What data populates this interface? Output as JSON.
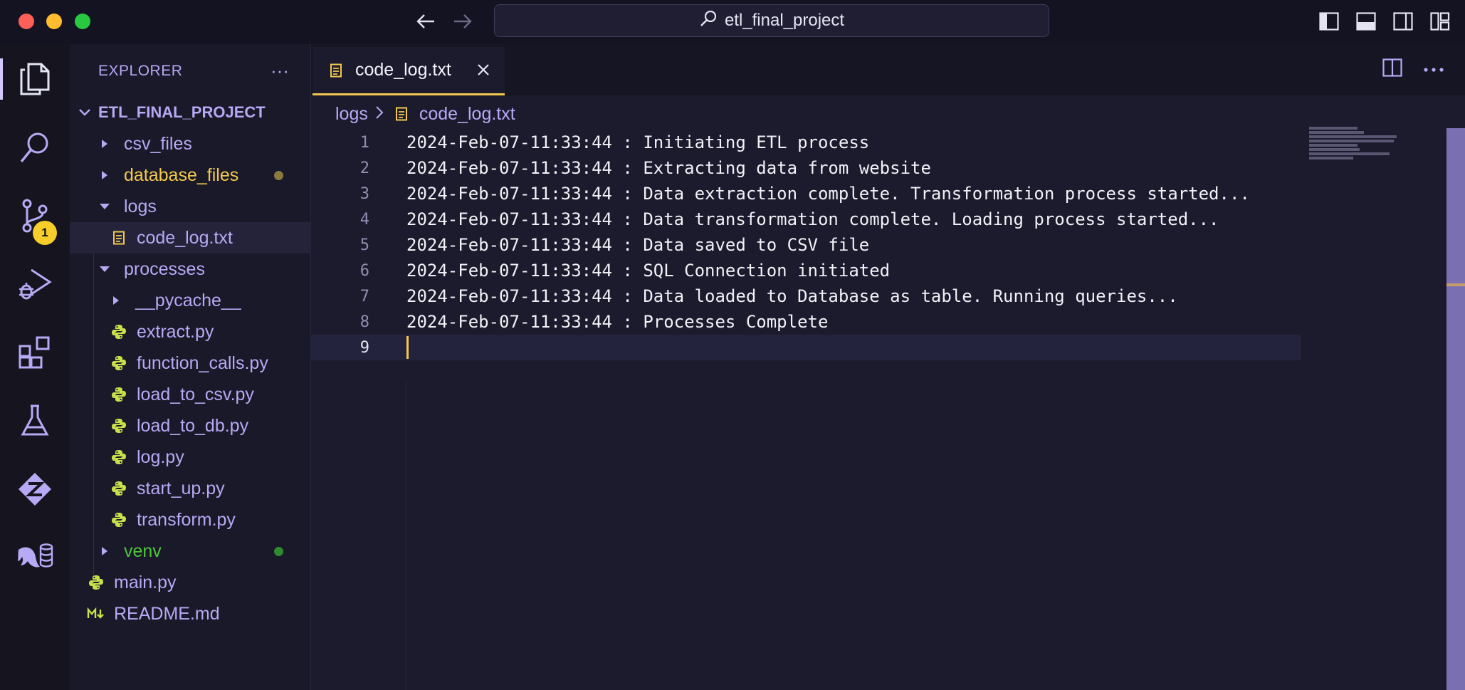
{
  "window": {
    "search_text": "etl_final_project"
  },
  "activity_bar": {
    "source_control_badge": "1"
  },
  "sidebar": {
    "header": "EXPLORER",
    "more": "···",
    "project": "ETL_FINAL_PROJECT",
    "tree": [
      {
        "label": "csv_files",
        "kind": "folder",
        "color": "#b7a9f4"
      },
      {
        "label": "database_files",
        "kind": "folder",
        "color": "#f2c94c",
        "dot": "#8a7a3e"
      },
      {
        "label": "logs",
        "kind": "folder-open",
        "color": "#b7a9f4"
      },
      {
        "label": "code_log.txt",
        "kind": "txt",
        "color": "#b7a9f4",
        "selected": true
      },
      {
        "label": "processes",
        "kind": "folder-open",
        "color": "#b7a9f4"
      },
      {
        "label": "__pycache__",
        "kind": "folder",
        "color": "#b7a9f4"
      },
      {
        "label": "extract.py",
        "kind": "py",
        "color": "#b7a9f4"
      },
      {
        "label": "function_calls.py",
        "kind": "py",
        "color": "#b7a9f4"
      },
      {
        "label": "load_to_csv.py",
        "kind": "py",
        "color": "#b7a9f4"
      },
      {
        "label": "load_to_db.py",
        "kind": "py",
        "color": "#b7a9f4"
      },
      {
        "label": "log.py",
        "kind": "py",
        "color": "#b7a9f4"
      },
      {
        "label": "start_up.py",
        "kind": "py",
        "color": "#b7a9f4"
      },
      {
        "label": "transform.py",
        "kind": "py",
        "color": "#b7a9f4"
      },
      {
        "label": "venv",
        "kind": "folder",
        "color": "#4ec43a",
        "dot": "#2e8b2e"
      },
      {
        "label": "main.py",
        "kind": "py",
        "color": "#b7a9f4"
      },
      {
        "label": "README.md",
        "kind": "md",
        "color": "#b7a9f4"
      }
    ]
  },
  "editor": {
    "tab_label": "code_log.txt",
    "breadcrumb": {
      "folder": "logs",
      "file": "code_log.txt"
    },
    "lines": [
      "2024-Feb-07-11:33:44 : Initiating ETL process",
      "2024-Feb-07-11:33:44 : Extracting data from website",
      "2024-Feb-07-11:33:44 : Data extraction complete. Transformation process started...",
      "2024-Feb-07-11:33:44 : Data transformation complete. Loading process started...",
      "2024-Feb-07-11:33:44 : Data saved to CSV file",
      "2024-Feb-07-11:33:44 : SQL Connection initiated",
      "2024-Feb-07-11:33:44 : Data loaded to Database as table. Running queries...",
      "2024-Feb-07-11:33:44 : Processes Complete",
      ""
    ],
    "current_line": 9
  },
  "colors": {
    "accent": "#f2c94c",
    "sidebar_text": "#b7a9f4",
    "badge": "#f6cd2a"
  }
}
